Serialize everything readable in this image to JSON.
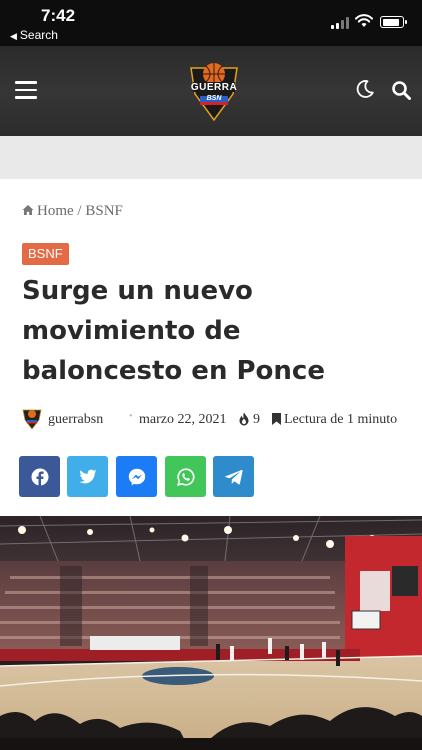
{
  "status_bar": {
    "time": "7:42",
    "back_label": "Search"
  },
  "header": {
    "logo_text": "GUERRA",
    "logo_subtext": "BSN",
    "icons": [
      "menu-icon",
      "moon-icon",
      "search-icon"
    ]
  },
  "breadcrumb": {
    "home": "Home",
    "separator": "/",
    "section": "BSNF"
  },
  "article": {
    "category": "BSNF",
    "title": "Surge un nuevo movimiento de baloncesto en Ponce",
    "author": "guerrabsn",
    "date": "marzo 22, 2021",
    "views": "9",
    "read_time": "Lectura de 1 minuto"
  },
  "share": {
    "buttons": [
      {
        "name": "facebook",
        "color": "#3b5998"
      },
      {
        "name": "twitter",
        "color": "#40aee8"
      },
      {
        "name": "messenger",
        "color": "#1b7cf5"
      },
      {
        "name": "whatsapp",
        "color": "#42c65a"
      },
      {
        "name": "telegram",
        "color": "#2e8ccd"
      }
    ]
  },
  "colors": {
    "badge": "#e46a46",
    "header_bg": "#2c2c2c"
  }
}
